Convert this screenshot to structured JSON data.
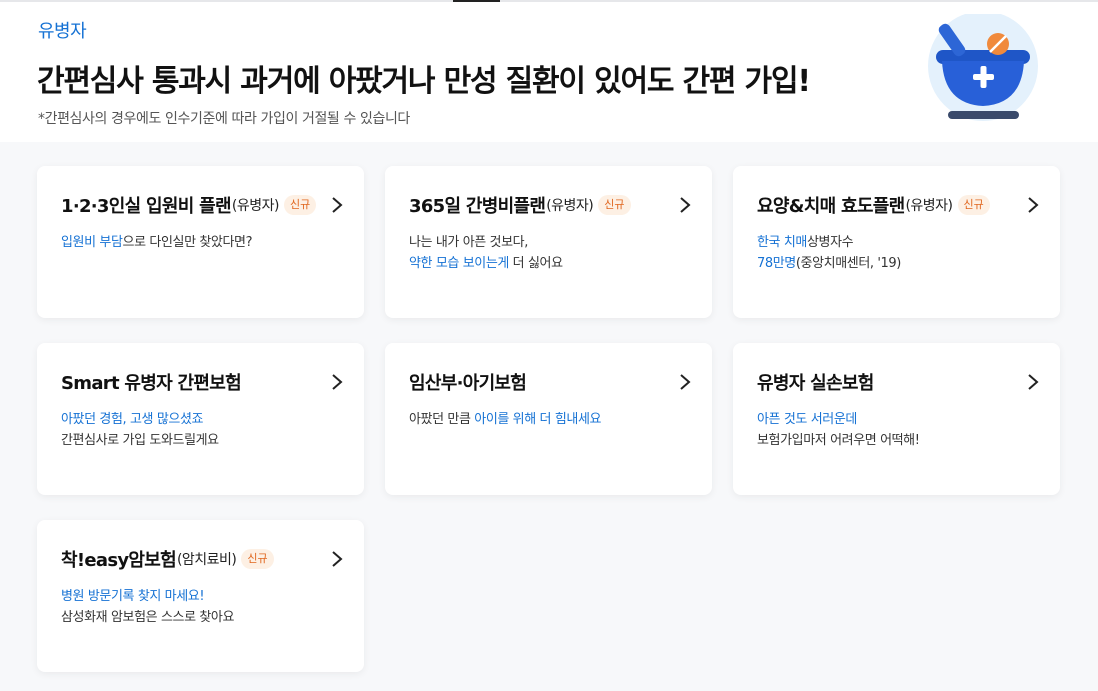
{
  "header": {
    "category": "유병자",
    "headline": "간편심사 통과시 과거에 아팠거나 만성 질환이 있어도 간편 가입!",
    "disclaimer": "*간편심사의 경우에도 인수기준에 따라 가입이 거절될 수 있습니다",
    "illustration_icon": "mortar-pill-medicine-icon"
  },
  "colors": {
    "accent_blue": "#1672d4",
    "badge_bg": "#fdf0e4",
    "badge_text": "#e0661e"
  },
  "cards": [
    {
      "title": "1·2·3인실 입원비 플랜",
      "suffix": "(유병자)",
      "badge": "신규",
      "desc1_hl": "입원비 부담",
      "desc1_rest": "으로 다인실만 찾았다면?",
      "desc2_hl": "",
      "desc2_rest": ""
    },
    {
      "title": "365일 간병비플랜",
      "suffix": "(유병자)",
      "badge": "신규",
      "desc1_hl": "",
      "desc1_rest": "나는 내가 아픈 것보다,",
      "desc2_hl": "약한 모습 보이는게",
      "desc2_rest": " 더 싫어요"
    },
    {
      "title": "요양&치매 효도플랜",
      "suffix": "(유병자)",
      "badge": "신규",
      "desc1_hl": "한국 치매",
      "desc1_rest": "상병자수",
      "desc2_hl": "78만명",
      "desc2_rest": "(중앙치매센터, '19)"
    },
    {
      "title": "Smart 유병자 간편보험",
      "suffix": "",
      "badge": "",
      "desc1_hl": "아팠던 경험, 고생 많으셨죠",
      "desc1_rest": "",
      "desc2_hl": "",
      "desc2_rest": "간편심사로 가입 도와드릴게요"
    },
    {
      "title": "임산부·아기보험",
      "suffix": "",
      "badge": "",
      "desc1_hl": "",
      "desc1_rest": "아팠던 만큼 ",
      "desc1_hl2": "아이를 위해 더 힘내세요",
      "desc2_hl": "",
      "desc2_rest": ""
    },
    {
      "title": "유병자 실손보험",
      "suffix": "",
      "badge": "",
      "desc1_hl": "아픈 것도 서러운데",
      "desc1_rest": "",
      "desc2_hl": "",
      "desc2_rest": "보험가입마저 어려우면 어떡해!"
    },
    {
      "title": "착!easy암보험",
      "suffix": "(암치료비)",
      "badge": "신규",
      "desc1_hl": "병원 방문기록 찾지 마세요!",
      "desc1_rest": "",
      "desc2_hl": "",
      "desc2_rest": "삼성화재 암보험은 스스로 찾아요"
    }
  ]
}
